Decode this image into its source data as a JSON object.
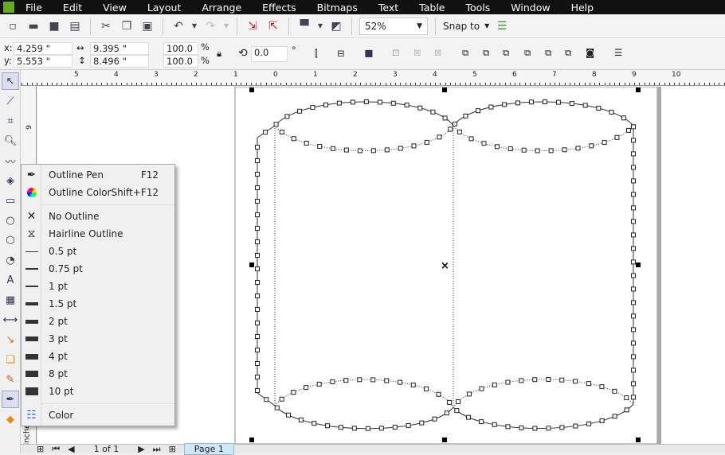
{
  "menu": [
    "File",
    "Edit",
    "View",
    "Layout",
    "Arrange",
    "Effects",
    "Bitmaps",
    "Text",
    "Table",
    "Tools",
    "Window",
    "Help"
  ],
  "toolbar": {
    "zoom": "52%",
    "snap": "Snap to"
  },
  "props": {
    "x_label": "x:",
    "x": "4.259 \"",
    "y_label": "y:",
    "y": "5.553 \"",
    "w": "9.395 \"",
    "h": "8.496 \"",
    "scale_x": "100.0",
    "scale_y": "100.0",
    "pct": "%",
    "angle": "0.0",
    "deg": "°"
  },
  "ruler": {
    "h_labels": [
      "5",
      "4",
      "3",
      "2",
      "1",
      "0",
      "1",
      "2",
      "3",
      "4",
      "5",
      "6",
      "7",
      "8",
      "9",
      "10"
    ],
    "v_label": "9",
    "units": "inches"
  },
  "flyout": {
    "items": [
      {
        "label": "Outline Pen",
        "shortcut": "F12",
        "icon": "pen-nib-icon"
      },
      {
        "label": "Outline Color",
        "shortcut": "Shift+F12",
        "icon": "color-wheel-icon"
      },
      {
        "label": "No Outline",
        "icon": "x-icon"
      },
      {
        "label": "Hairline Outline",
        "icon": "hairline-icon"
      },
      {
        "label": "0.5 pt",
        "w": 1
      },
      {
        "label": "0.75 pt",
        "w": 1.5
      },
      {
        "label": "1 pt",
        "w": 2.5
      },
      {
        "label": "1.5 pt",
        "w": 3.5
      },
      {
        "label": "2 pt",
        "w": 5
      },
      {
        "label": "3 pt",
        "w": 6
      },
      {
        "label": "4 pt",
        "w": 7
      },
      {
        "label": "8 pt",
        "w": 8
      },
      {
        "label": "10 pt",
        "w": 10
      },
      {
        "label": "Color",
        "icon": "color-docker-icon"
      }
    ]
  },
  "status": {
    "page_count": "1 of 1",
    "page_tab": "Page 1"
  }
}
